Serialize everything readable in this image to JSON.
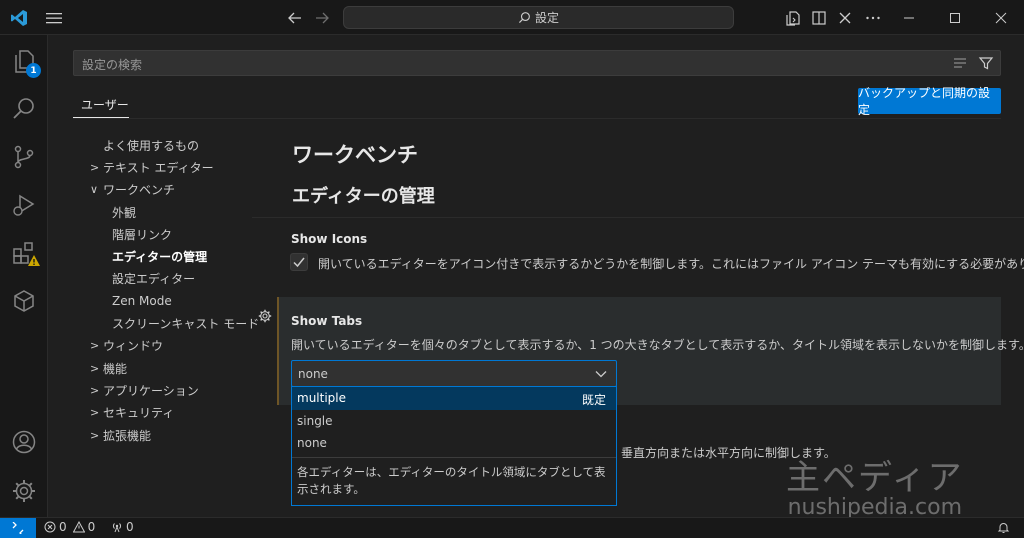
{
  "titlebar": {
    "command_center": "設定"
  },
  "activity_bar": {
    "explorer_badge": "1"
  },
  "settings": {
    "search_placeholder": "設定の検索",
    "scope_tab": "ユーザー",
    "backup_button": "バックアップと同期の設定",
    "toc": [
      {
        "label": "よく使用するもの",
        "level": 0,
        "chevron": ""
      },
      {
        "label": "テキスト エディター",
        "level": 0,
        "chevron": ">"
      },
      {
        "label": "ワークベンチ",
        "level": 0,
        "chevron": "∨"
      },
      {
        "label": "外観",
        "level": 1,
        "chevron": ""
      },
      {
        "label": "階層リンク",
        "level": 1,
        "chevron": ""
      },
      {
        "label": "エディターの管理",
        "level": 1,
        "chevron": "",
        "active": true
      },
      {
        "label": "設定エディター",
        "level": 1,
        "chevron": ""
      },
      {
        "label": "Zen Mode",
        "level": 1,
        "chevron": ""
      },
      {
        "label": "スクリーンキャスト モード",
        "level": 1,
        "chevron": ""
      },
      {
        "label": "ウィンドウ",
        "level": 0,
        "chevron": ">"
      },
      {
        "label": "機能",
        "level": 0,
        "chevron": ">"
      },
      {
        "label": "アプリケーション",
        "level": 0,
        "chevron": ">"
      },
      {
        "label": "セキュリティ",
        "level": 0,
        "chevron": ">"
      },
      {
        "label": "拡張機能",
        "level": 0,
        "chevron": ">"
      }
    ],
    "heading": "ワークベンチ",
    "subheading": "エディターの管理",
    "show_icons": {
      "title": "Show Icons",
      "description": "開いているエディターをアイコン付きで表示するかどうかを制御します。これにはファイル アイコン テーマも有効にする必要があります。",
      "checked": true
    },
    "show_tabs": {
      "title": "Show Tabs",
      "description": "開いているエディターを個々のタブとして表示するか、1 つの大きなタブとして表示するか、タイトル領域を表示しないかを制御します。",
      "value": "none",
      "options": [
        {
          "label": "multiple",
          "badge": "既定"
        },
        {
          "label": "single",
          "badge": ""
        },
        {
          "label": "none",
          "badge": ""
        }
      ],
      "option_description": "各エディターは、エディターのタイトル領域にタブとして表示されます。"
    },
    "obscured_text": "垂直方向または水平方向に制御します。"
  },
  "watermark": {
    "line1": "主ペディア",
    "line2": "nushipedia.com"
  },
  "statusbar": {
    "errors": "0",
    "warnings": "0",
    "ports": "0"
  },
  "colors": {
    "accent": "#0078d4",
    "background": "#1f1f1f",
    "sidebar": "#181818"
  }
}
